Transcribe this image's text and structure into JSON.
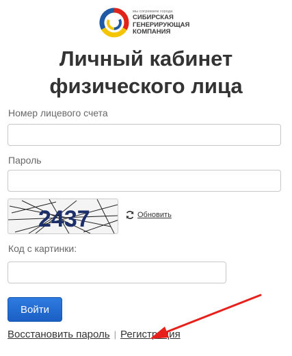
{
  "brand": {
    "tagline": "мы согреваем города",
    "name_line1": "Сибирская",
    "name_line2": "Генерирующая",
    "name_line3": "Компания",
    "colors": {
      "red": "#e2231a",
      "yellow": "#f5c400",
      "blue": "#1f5aa6"
    }
  },
  "page": {
    "title_line1": "Личный кабинет",
    "title_line2": "физического лица"
  },
  "form": {
    "account_label": "Номер лицевого счета",
    "account_value": "",
    "password_label": "Пароль",
    "password_value": "",
    "captcha_text": "2437",
    "refresh_label": "Обновить",
    "captcha_code_label": "Код с картинки:",
    "captcha_code_value": "",
    "submit_label": "Войти"
  },
  "links": {
    "restore_password": "Восстановить пароль",
    "separator": "|",
    "register": "Регистрация"
  },
  "annotation": {
    "arrow_color": "#e8201b"
  }
}
